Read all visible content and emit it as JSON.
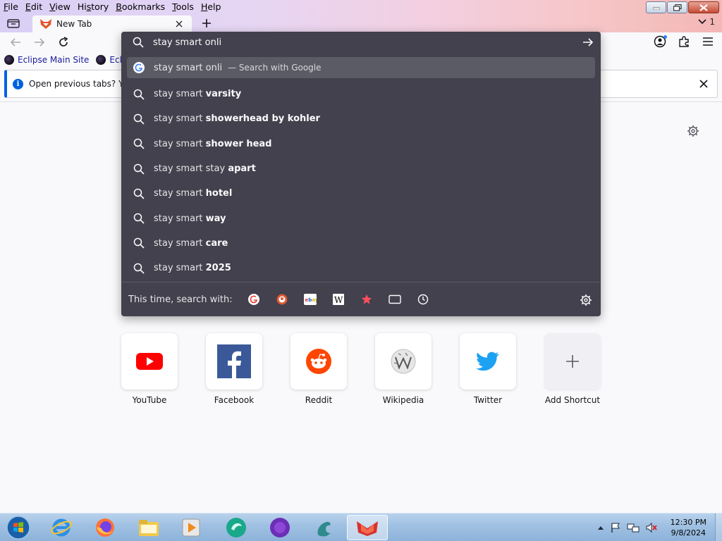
{
  "menu": [
    {
      "accel": "F",
      "rest": "ile"
    },
    {
      "accel": "E",
      "rest": "dit"
    },
    {
      "accel": "V",
      "rest": "iew"
    },
    {
      "accel": "H",
      "rest": "istory",
      "split": "Hi",
      "pre": "Hi",
      "post": "story"
    },
    {
      "accel": "B",
      "rest": "ookmarks"
    },
    {
      "accel": "T",
      "rest": "ools"
    },
    {
      "accel": "H",
      "rest": "elp"
    }
  ],
  "menu_labels": {
    "file": {
      "u": "F",
      "r": "ile"
    },
    "edit": {
      "u": "E",
      "r": "dit"
    },
    "view": {
      "u": "V",
      "r": "iew"
    },
    "history": {
      "p": "Hi",
      "u": "s",
      "r": "tory"
    },
    "bookmarks": {
      "u": "B",
      "r": "ookmarks"
    },
    "tools": {
      "u": "T",
      "r": "ools"
    },
    "help": {
      "u": "H",
      "r": "elp"
    }
  },
  "tab": {
    "title": "New Tab"
  },
  "tab_overflow": {
    "count": "1"
  },
  "bookmarks": [
    {
      "label": "Eclipse Main Site"
    },
    {
      "label": "Eclips"
    }
  ],
  "notification": {
    "text": "Open previous tabs? You"
  },
  "urlbar": {
    "value": "stay smart onli",
    "results": [
      {
        "prefix": "stay smart onli",
        "bold": "",
        "action": "— Search with Google",
        "icon": "google-icon"
      },
      {
        "prefix": "stay smart ",
        "bold": "varsity",
        "icon": "search-icon"
      },
      {
        "prefix": "stay smart ",
        "bold": "showerhead by kohler",
        "icon": "search-icon"
      },
      {
        "prefix": "stay smart ",
        "bold": "shower head",
        "icon": "search-icon"
      },
      {
        "prefix": "stay smart stay ",
        "bold": "apart",
        "icon": "search-icon"
      },
      {
        "prefix": "stay smart ",
        "bold": "hotel",
        "icon": "search-icon"
      },
      {
        "prefix": "stay smart ",
        "bold": "way",
        "icon": "search-icon"
      },
      {
        "prefix": "stay smart ",
        "bold": "care",
        "icon": "search-icon"
      },
      {
        "prefix": "stay smart ",
        "bold": "2025",
        "icon": "search-icon"
      }
    ],
    "oneoff_label": "This time, search with:",
    "engines": [
      "google-icon",
      "duckduckgo-icon",
      "ebay-icon",
      "wikipedia-icon",
      "bookmarks-star-icon",
      "tabs-icon",
      "history-icon"
    ]
  },
  "shortcuts": [
    {
      "label": "YouTube",
      "icon": "youtube-icon"
    },
    {
      "label": "Facebook",
      "icon": "facebook-icon"
    },
    {
      "label": "Reddit",
      "icon": "reddit-icon"
    },
    {
      "label": "Wikipedia",
      "icon": "wikipedia-icon"
    },
    {
      "label": "Twitter",
      "icon": "twitter-icon"
    },
    {
      "label": "Add Shortcut",
      "icon": "plus-icon"
    }
  ],
  "taskbar": {
    "apps": [
      "internet-explorer-icon",
      "firefox-icon",
      "file-explorer-icon",
      "media-player-icon",
      "app-green-icon",
      "app-purple-icon",
      "app-dragon-icon",
      "app-active-browser-icon"
    ],
    "time": "12:30 PM",
    "date": "9/8/2024"
  },
  "colors": {
    "popup_bg": "#42414d",
    "selected_row": "#5b5b66",
    "accent_blue": "#0060df",
    "taskbar": "#9fc0e2"
  }
}
